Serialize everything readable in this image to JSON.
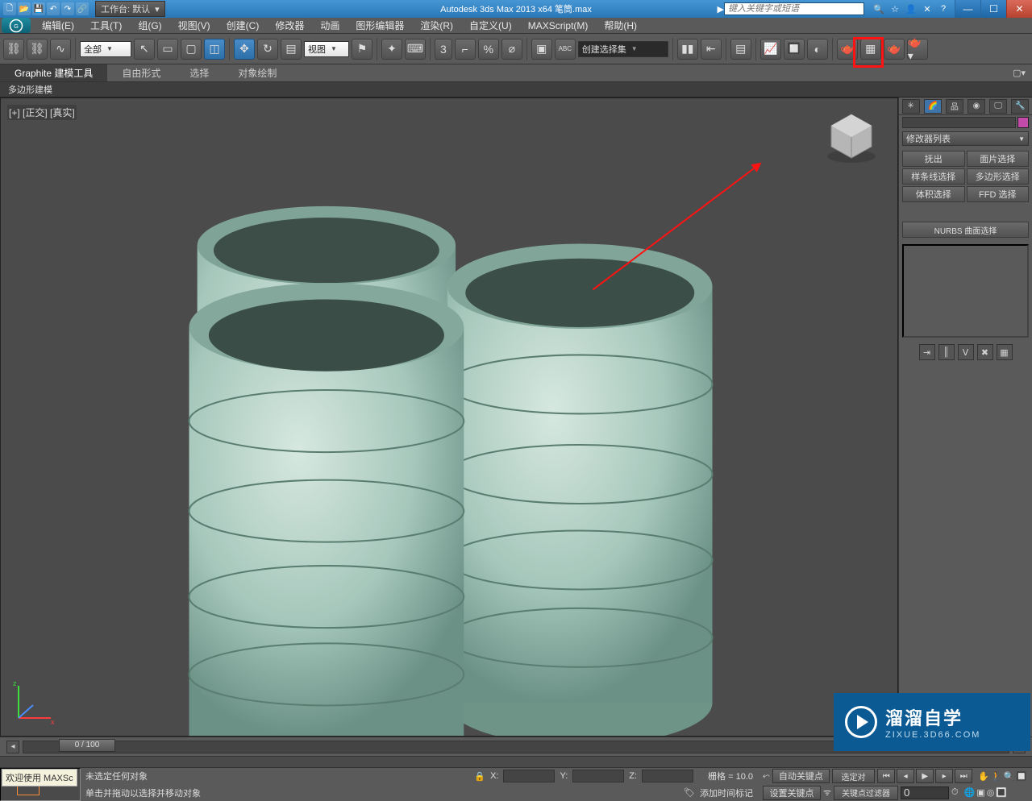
{
  "title": "Autodesk 3ds Max  2013 x64     笔筒.max",
  "search_placeholder": "键入关键字或短语",
  "workspace_label": "工作台: 默认",
  "menus": [
    "编辑(E)",
    "工具(T)",
    "组(G)",
    "视图(V)",
    "创建(C)",
    "修改器",
    "动画",
    "图形编辑器",
    "渲染(R)",
    "自定义(U)",
    "MAXScript(M)",
    "帮助(H)"
  ],
  "toolbar": {
    "filter_dd": "全部",
    "coord_dd": "视图",
    "selset_dd": "创建选择集"
  },
  "ribbon": {
    "tabs": [
      "Graphite 建模工具",
      "自由形式",
      "选择",
      "对象绘制"
    ],
    "sub": "多边形建模"
  },
  "viewport": {
    "label": "[+] [正交] [真实]"
  },
  "right_panel": {
    "mod_dd": "修改器列表",
    "btns": [
      "抚出",
      "面片选择",
      "样条线选择",
      "多边形选择",
      "体积选择",
      "FFD 选择"
    ],
    "nurbs": "NURBS 曲面选择"
  },
  "timeline": {
    "head": "0 / 100"
  },
  "status": {
    "row1_a": "未选定任何对象",
    "row2_a": "单击并拖动以选择并移动对象",
    "grid_label": "栅格 = 10.0",
    "autokey": "自动关键点",
    "setkey": "设置关键点",
    "sel_obj": "选定对",
    "filter": "关键点过滤器",
    "add_time": "添加时间标记",
    "coord_x": "X:",
    "coord_y": "Y:",
    "coord_z": "Z:"
  },
  "welcome": "欢迎使用 MAXSc",
  "watermark": {
    "big": "溜溜自学",
    "small": "ZIXUE.3D66.COM"
  }
}
